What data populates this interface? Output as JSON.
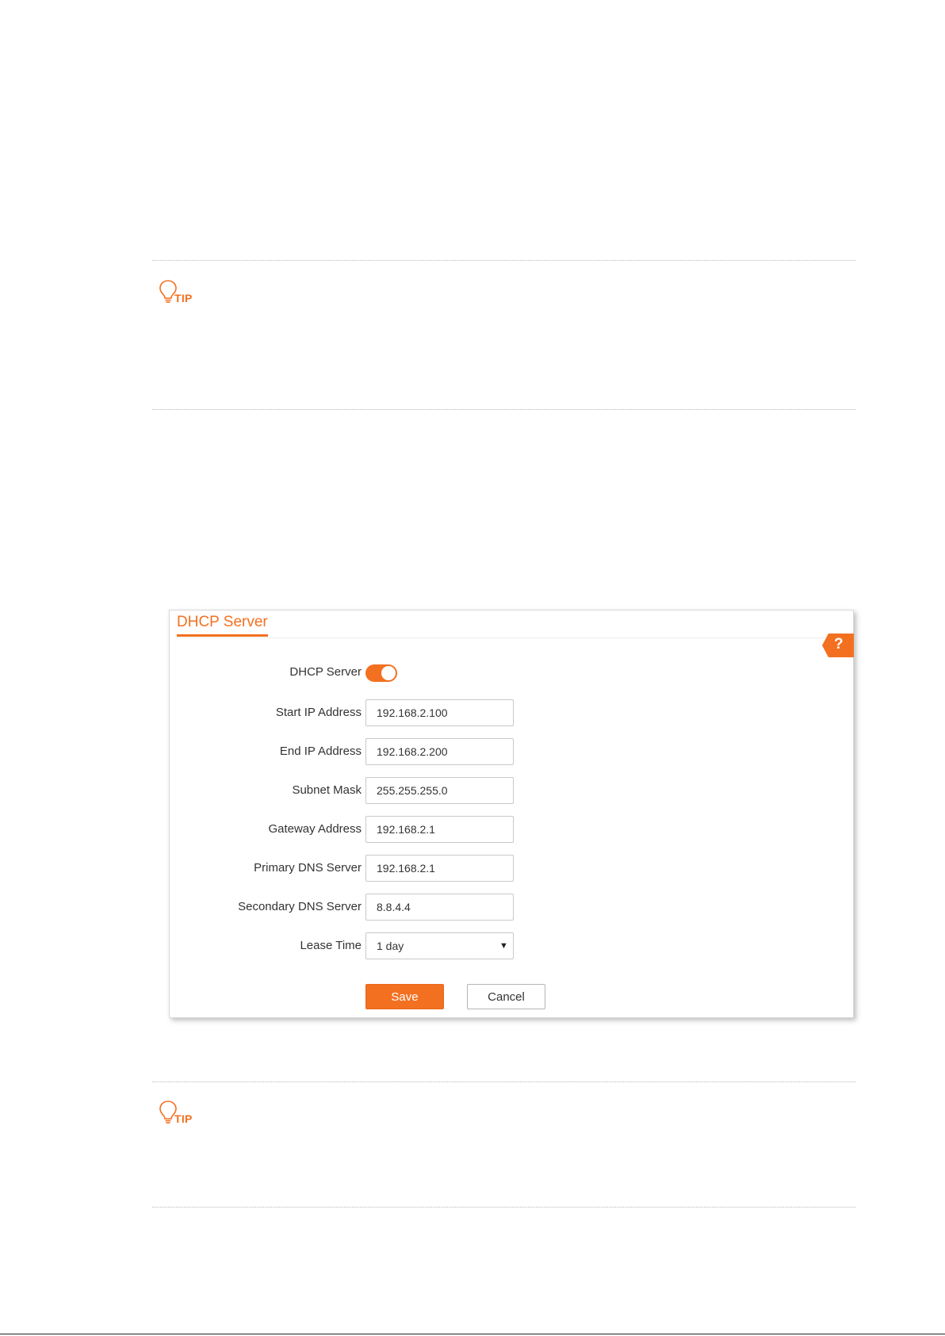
{
  "tips": [
    {
      "label": "TIP"
    },
    {
      "label": "TIP"
    }
  ],
  "panel": {
    "title": "DHCP Server",
    "help_label": "?",
    "fields": [
      {
        "label": "DHCP Server",
        "type": "toggle",
        "enabled": true
      },
      {
        "label": "Start IP Address",
        "type": "text",
        "value": "192.168.2.100"
      },
      {
        "label": "End IP Address",
        "type": "text",
        "value": "192.168.2.200"
      },
      {
        "label": "Subnet Mask",
        "type": "text",
        "value": "255.255.255.0"
      },
      {
        "label": "Gateway Address",
        "type": "text",
        "value": "192.168.2.1"
      },
      {
        "label": "Primary DNS Server",
        "type": "text",
        "value": "192.168.2.1"
      },
      {
        "label": "Secondary DNS Server",
        "type": "text",
        "value": "8.8.4.4"
      },
      {
        "label": "Lease Time",
        "type": "select",
        "value": "1 day"
      }
    ],
    "save_label": "Save",
    "cancel_label": "Cancel"
  },
  "colors": {
    "accent": "#f37021",
    "text": "#333333",
    "border": "#c9c9c9"
  }
}
